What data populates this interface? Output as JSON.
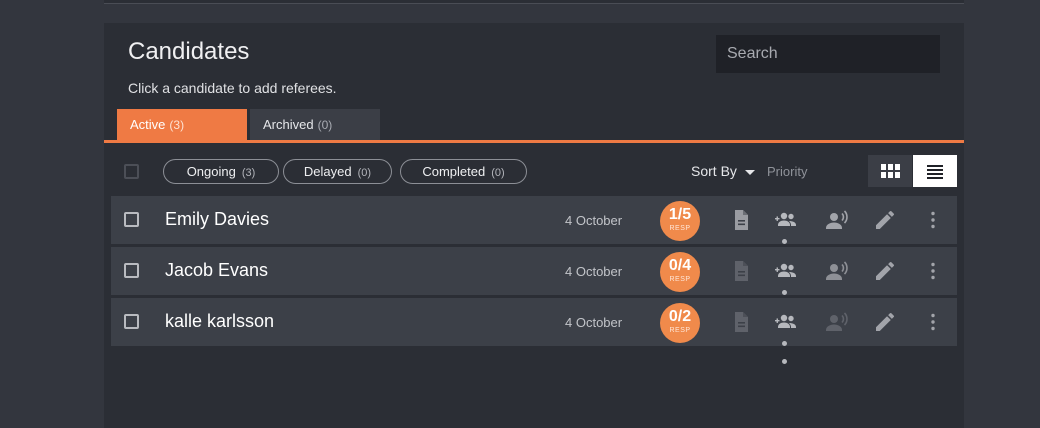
{
  "panel": {
    "title": "Candidates",
    "subtitle": "Click a candidate to add referees.",
    "search_placeholder": "Search"
  },
  "tabs": [
    {
      "label": "Active",
      "count": "(3)",
      "active": true
    },
    {
      "label": "Archived",
      "count": "(0)",
      "active": false
    }
  ],
  "filters": [
    {
      "label": "Ongoing",
      "count": "(3)"
    },
    {
      "label": "Delayed",
      "count": "(0)"
    },
    {
      "label": "Completed",
      "count": "(0)"
    }
  ],
  "sort": {
    "label": "Sort By",
    "value": "Priority"
  },
  "colors": {
    "accent": "#ef7a44",
    "badge": "#f08a4b",
    "row_bg": "#3c4048",
    "panel_bg": "#2b2e35"
  },
  "icons": {
    "document": "document-icon",
    "referees": "add-referee-icon",
    "voice": "voice-icon",
    "edit": "pencil-icon",
    "more": "more-vertical-icon",
    "grid_view": "grid-view-icon",
    "list_view": "list-view-icon"
  },
  "candidates": [
    {
      "name": "Emily Davies",
      "date": "4 October",
      "responses": "1/5",
      "resp_label": "RESP"
    },
    {
      "name": "Jacob Evans",
      "date": "4 October",
      "responses": "0/4",
      "resp_label": "RESP"
    },
    {
      "name": "kalle karlsson",
      "date": "4 October",
      "responses": "0/2",
      "resp_label": "RESP"
    }
  ]
}
